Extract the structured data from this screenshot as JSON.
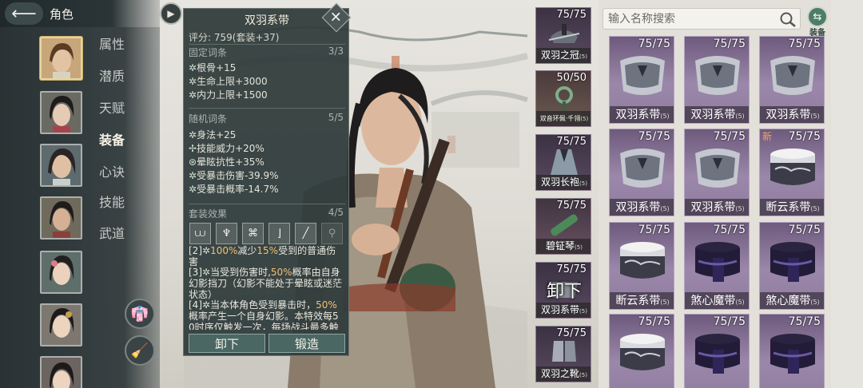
{
  "header": {
    "title": "角色",
    "back_icon": "arrow-left-icon"
  },
  "sidebar": {
    "nav": [
      "属性",
      "潜质",
      "天赋",
      "装备",
      "心诀",
      "技能",
      "武道"
    ],
    "selected_nav": "装备",
    "buttons": [
      "outfit-icon",
      "broom-icon"
    ]
  },
  "tooltip": {
    "title": "双羽系带",
    "score": "评分: 759(套装+37)",
    "fixed_header": "固定词条",
    "fixed_count": "3/3",
    "fixed": [
      "根骨+15",
      "生命上限+3000",
      "内力上限+1500"
    ],
    "random_header": "随机词条",
    "random_count": "5/5",
    "random": [
      "身法+25",
      "技能威力+20%",
      "晕眩抗性+35%",
      "受暴击伤害-39.9%",
      "受暴击概率-14.7%"
    ],
    "set_header": "套装效果",
    "set_count": "4/5",
    "set_effects": [
      {
        "tag": "[2]",
        "pre": "",
        "hl": "100%",
        "mid": "减少",
        "hl2": "15%",
        "post": "受到的普通伤害"
      },
      {
        "tag": "[3]",
        "pre": "当受到伤害时,",
        "hl": "50%",
        "mid": "概率由自身幻影挡刀（幻影不能处于晕眩或迷茫状态）",
        "hl2": "",
        "post": ""
      },
      {
        "tag": "[4]",
        "pre": "当本体角色受到暴击时，",
        "hl": "50%",
        "mid": "概率产生一个自身幻影。本特效每5 0时序仅触发一次，每场战斗最多触",
        "hl2": "",
        "post": ""
      }
    ],
    "unequip_label": "卸下",
    "forge_label": "锻造"
  },
  "equipped": [
    {
      "name": "双羽之冠",
      "level": "(5)",
      "count": "75/75"
    },
    {
      "name": "双音环佩·千翎",
      "level": "(5)",
      "count": "50/50"
    },
    {
      "name": "双羽长袍",
      "level": "(5)",
      "count": "75/75"
    },
    {
      "name": "碧钲琴",
      "level": "(5)",
      "count": "75/75"
    },
    {
      "name": "双羽系带",
      "level": "(5)",
      "count": "75/75",
      "overlay": "卸下"
    },
    {
      "name": "双羽之靴",
      "level": "(5)",
      "count": "75/75"
    }
  ],
  "search": {
    "placeholder": "输入名称搜索"
  },
  "equip_toggle_label": "装备",
  "inventory": [
    {
      "name": "双羽系带",
      "level": "(5)",
      "count": "75/75",
      "kind": "belt"
    },
    {
      "name": "双羽系带",
      "level": "(5)",
      "count": "75/75",
      "kind": "belt"
    },
    {
      "name": "双羽系带",
      "level": "(5)",
      "count": "75/75",
      "kind": "belt"
    },
    {
      "name": "双羽系带",
      "level": "(5)",
      "count": "75/75",
      "kind": "belt"
    },
    {
      "name": "双羽系带",
      "level": "(5)",
      "count": "75/75",
      "kind": "belt"
    },
    {
      "name": "断云系带",
      "level": "(5)",
      "count": "75/75",
      "kind": "cloud",
      "new": "新"
    },
    {
      "name": "断云系带",
      "level": "(5)",
      "count": "75/75",
      "kind": "cloud"
    },
    {
      "name": "煞心魔带",
      "level": "(5)",
      "count": "75/75",
      "kind": "demon"
    },
    {
      "name": "煞心魔带",
      "level": "(5)",
      "count": "75/75",
      "kind": "demon"
    },
    {
      "name": "",
      "level": "",
      "count": "75/75",
      "kind": "cloud"
    },
    {
      "name": "",
      "level": "",
      "count": "75/75",
      "kind": "demon"
    },
    {
      "name": "",
      "level": "",
      "count": "75/75",
      "kind": "demon"
    }
  ],
  "colors": {
    "card_purple": "#8f7c9e",
    "highlight": "#f0c070",
    "panel": "#303c3c"
  }
}
